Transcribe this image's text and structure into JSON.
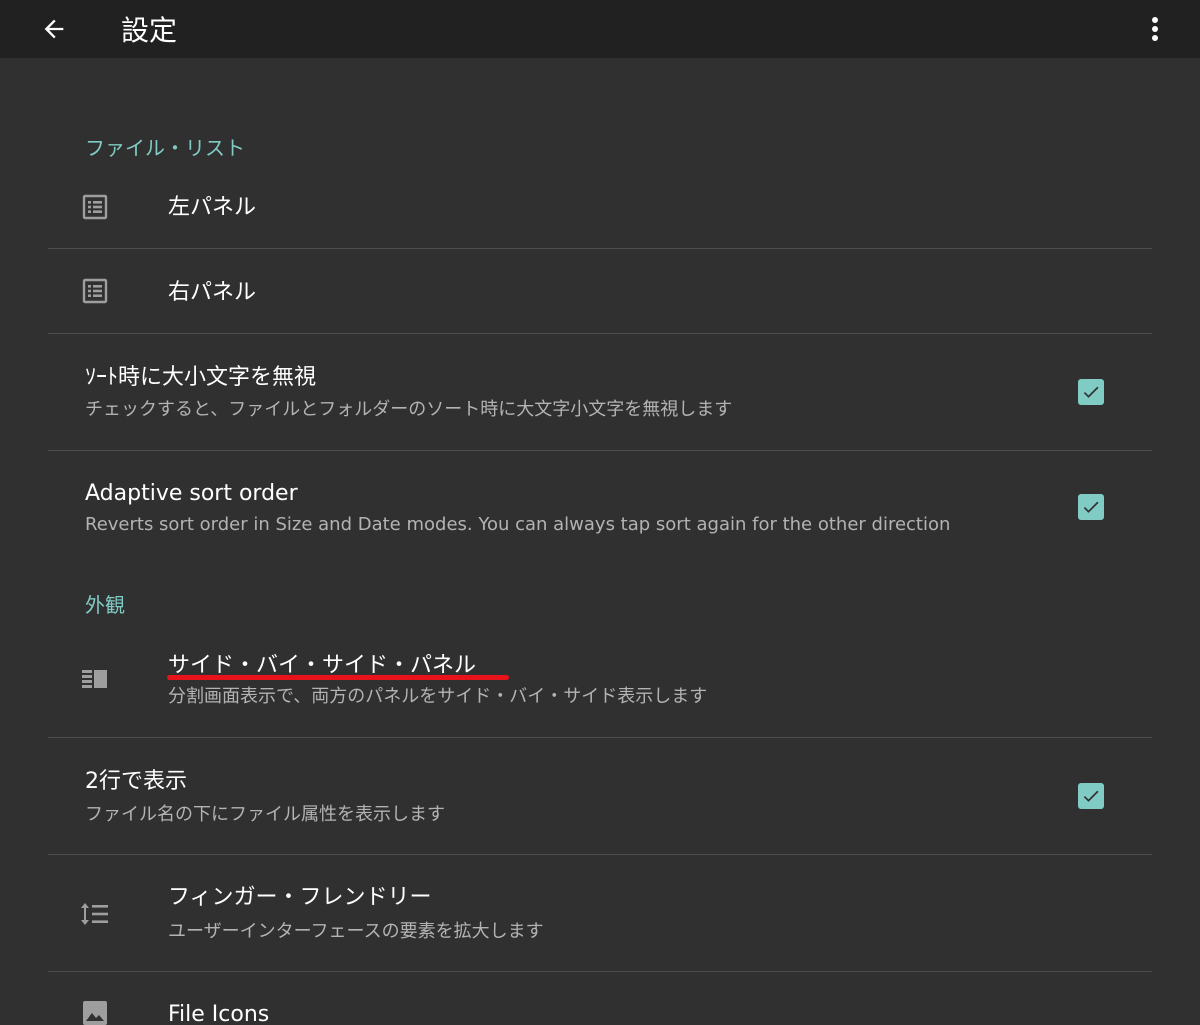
{
  "appbar": {
    "back_icon": "arrow-back-icon",
    "title": "設定",
    "overflow_icon": "more-vert-icon"
  },
  "sections": [
    {
      "header": "ファイル・リスト",
      "items": [
        {
          "title": "左パネル",
          "icon": "list-alt-icon"
        },
        {
          "title": "右パネル",
          "icon": "list-alt-icon"
        },
        {
          "title": "ｿｰﾄ時に大小文字を無視",
          "summary": "チェックすると、ファイルとフォルダーのソート時に大文字小文字を無視します",
          "checked": true
        },
        {
          "title": "Adaptive sort order",
          "summary": "Reverts sort order in Size and Date modes. You can always tap sort again for the other direction",
          "checked": true
        }
      ]
    },
    {
      "header": "外観",
      "items": [
        {
          "title": "サイド・バイ・サイド・パネル",
          "summary": "分割画面表示で、両方のパネルをサイド・バイ・サイド表示します",
          "icon": "side-by-side-icon"
        },
        {
          "title": "2行で表示",
          "summary": "ファイル名の下にファイル属性を表示します",
          "checked": true
        },
        {
          "title": "フィンガー・フレンドリー",
          "summary": "ユーザーインターフェースの要素を拡大します",
          "icon": "line-spacing-icon"
        },
        {
          "title": "File Icons",
          "icon": "image-icon"
        }
      ]
    }
  ],
  "colors": {
    "accent": "#80cbc4",
    "background": "#303030",
    "appbar": "#212121",
    "annotation_underline": "#e8121b"
  }
}
